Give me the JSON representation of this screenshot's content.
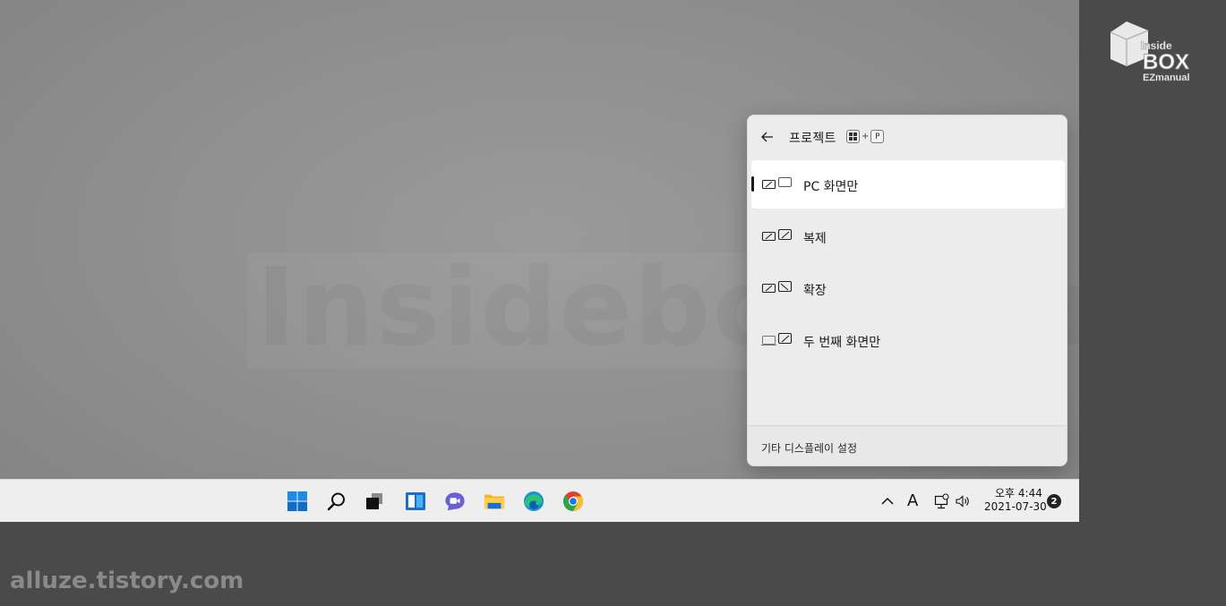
{
  "flyout": {
    "title": "프로젝트",
    "shortcut_plus": "+",
    "shortcut_key": "P",
    "options": [
      {
        "label": "PC 화면만",
        "icon": "pc-screen-only-icon",
        "selected": true
      },
      {
        "label": "복제",
        "icon": "duplicate-icon",
        "selected": false
      },
      {
        "label": "확장",
        "icon": "extend-icon",
        "selected": false
      },
      {
        "label": "두 번째 화면만",
        "icon": "second-screen-only-icon",
        "selected": false
      }
    ],
    "footer": "기타 디스플레이 설정"
  },
  "taskbar": {
    "apps": [
      "start-icon",
      "search-icon",
      "task-view-icon",
      "widgets-icon",
      "chat-icon",
      "file-explorer-icon",
      "edge-icon",
      "chrome-icon"
    ],
    "ime": "A",
    "time": "오후 4:44",
    "date": "2021-07-30",
    "notifications": "2"
  },
  "watermark": {
    "logo_top": "Inside",
    "logo_main": "BOX",
    "logo_sub": "EZmanual",
    "site": "alluze.tistory.com",
    "bg_text": "Insidebox EZmanual"
  },
  "colors": {
    "accent_blue": "#0078d4",
    "flyout_bg": "#ececec",
    "taskbar_bg": "#eeeeee"
  }
}
